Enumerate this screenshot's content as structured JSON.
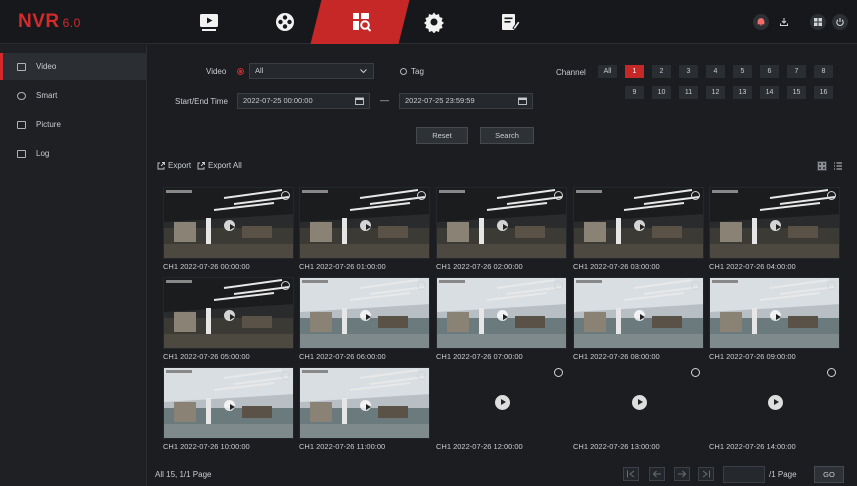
{
  "app": {
    "logo": "NVR",
    "version": "6.0"
  },
  "top_nav": [
    {
      "icon": "playback-icon"
    },
    {
      "icon": "ai-icon"
    },
    {
      "icon": "search-icon",
      "active": true
    },
    {
      "icon": "settings-icon"
    },
    {
      "icon": "maintenance-icon"
    }
  ],
  "top_right_icons": [
    "alarm-icon",
    "download-icon",
    "multi-screen-icon",
    "power-icon"
  ],
  "sidebar": {
    "items": [
      {
        "label": "Video",
        "active": true
      },
      {
        "label": "Smart"
      },
      {
        "label": "Picture"
      },
      {
        "label": "Log"
      }
    ]
  },
  "filters": {
    "video_label": "Video",
    "video_type": "All",
    "tag_label": "Tag",
    "time_label": "Start/End Time",
    "start_time": "2022-07-25 00:00:00",
    "end_time": "2022-07-25 23:59:59",
    "dash": "—",
    "channel_label": "Channel",
    "channel_all": "All",
    "channels_row1": [
      "1",
      "2",
      "3",
      "4",
      "5",
      "6",
      "7",
      "8"
    ],
    "channels_row2": [
      "9",
      "10",
      "11",
      "12",
      "13",
      "14",
      "15",
      "16"
    ],
    "selected_channel": "1",
    "reset": "Reset",
    "search": "Search"
  },
  "toolbar": {
    "export": "Export",
    "export_all": "Export All"
  },
  "results": [
    {
      "caption": "CH1 2022-07-26 00:00:00",
      "has_image": true
    },
    {
      "caption": "CH1 2022-07-26 01:00:00",
      "has_image": true
    },
    {
      "caption": "CH1 2022-07-26 02:00:00",
      "has_image": true
    },
    {
      "caption": "CH1 2022-07-26 03:00:00",
      "has_image": true
    },
    {
      "caption": "CH1 2022-07-26 04:00:00",
      "has_image": true
    },
    {
      "caption": "CH1 2022-07-26 05:00:00",
      "has_image": true
    },
    {
      "caption": "CH1 2022-07-26 06:00:00",
      "has_image": true
    },
    {
      "caption": "CH1 2022-07-26 07:00:00",
      "has_image": true
    },
    {
      "caption": "CH1 2022-07-26 08:00:00",
      "has_image": true
    },
    {
      "caption": "CH1 2022-07-26 09:00:00",
      "has_image": true
    },
    {
      "caption": "CH1 2022-07-26 10:00:00",
      "has_image": true
    },
    {
      "caption": "CH1 2022-07-26 11:00:00",
      "has_image": true
    },
    {
      "caption": "CH1 2022-07-26 12:00:00",
      "has_image": false
    },
    {
      "caption": "CH1 2022-07-26 13:00:00",
      "has_image": false
    },
    {
      "caption": "CH1 2022-07-26 14:00:00",
      "has_image": false
    }
  ],
  "footer": {
    "summary": "All 15, 1/1 Page",
    "page_input": "",
    "page_suffix": "/1 Page",
    "go": "GO"
  },
  "colors": {
    "accent": "#c62828",
    "background": "#1b1d21"
  }
}
